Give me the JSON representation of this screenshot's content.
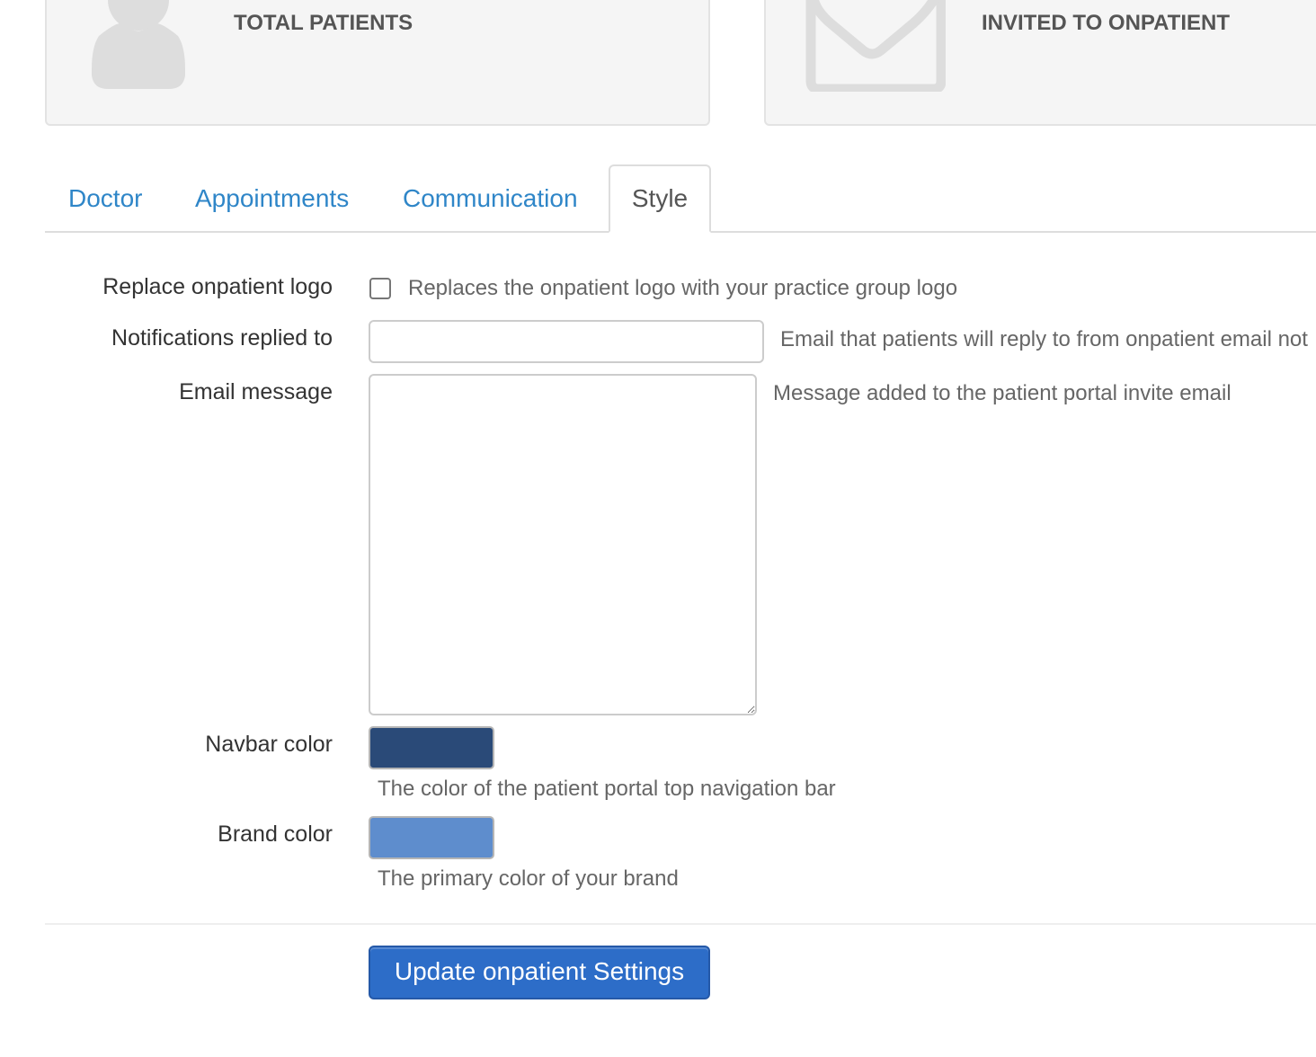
{
  "stats": {
    "cards": [
      {
        "title": "TOTAL PATIENTS",
        "icon": "user-icon"
      },
      {
        "title": "INVITED TO ONPATIENT",
        "icon": "envelope-icon"
      }
    ]
  },
  "tabs": [
    {
      "label": "Doctor",
      "active": false
    },
    {
      "label": "Appointments",
      "active": false
    },
    {
      "label": "Communication",
      "active": false
    },
    {
      "label": "Style",
      "active": true
    }
  ],
  "form": {
    "replace_logo": {
      "label": "Replace onpatient logo",
      "checked": false,
      "help": "Replaces the onpatient logo with your practice group logo"
    },
    "notifications_reply": {
      "label": "Notifications replied to",
      "value": "",
      "placeholder": "",
      "help": "Email that patients will reply to from onpatient email not"
    },
    "email_message": {
      "label": "Email message",
      "value": "",
      "help": "Message added to the patient portal invite email"
    },
    "navbar_color": {
      "label": "Navbar color",
      "value": "#2a4a78",
      "help": "The color of the patient portal top navigation bar"
    },
    "brand_color": {
      "label": "Brand color",
      "value": "#5e8dcd",
      "help": "The primary color of your brand"
    },
    "submit_label": "Update onpatient Settings"
  },
  "colors": {
    "tab_link": "#2f86c8",
    "primary_button": "#2d6dc8"
  }
}
